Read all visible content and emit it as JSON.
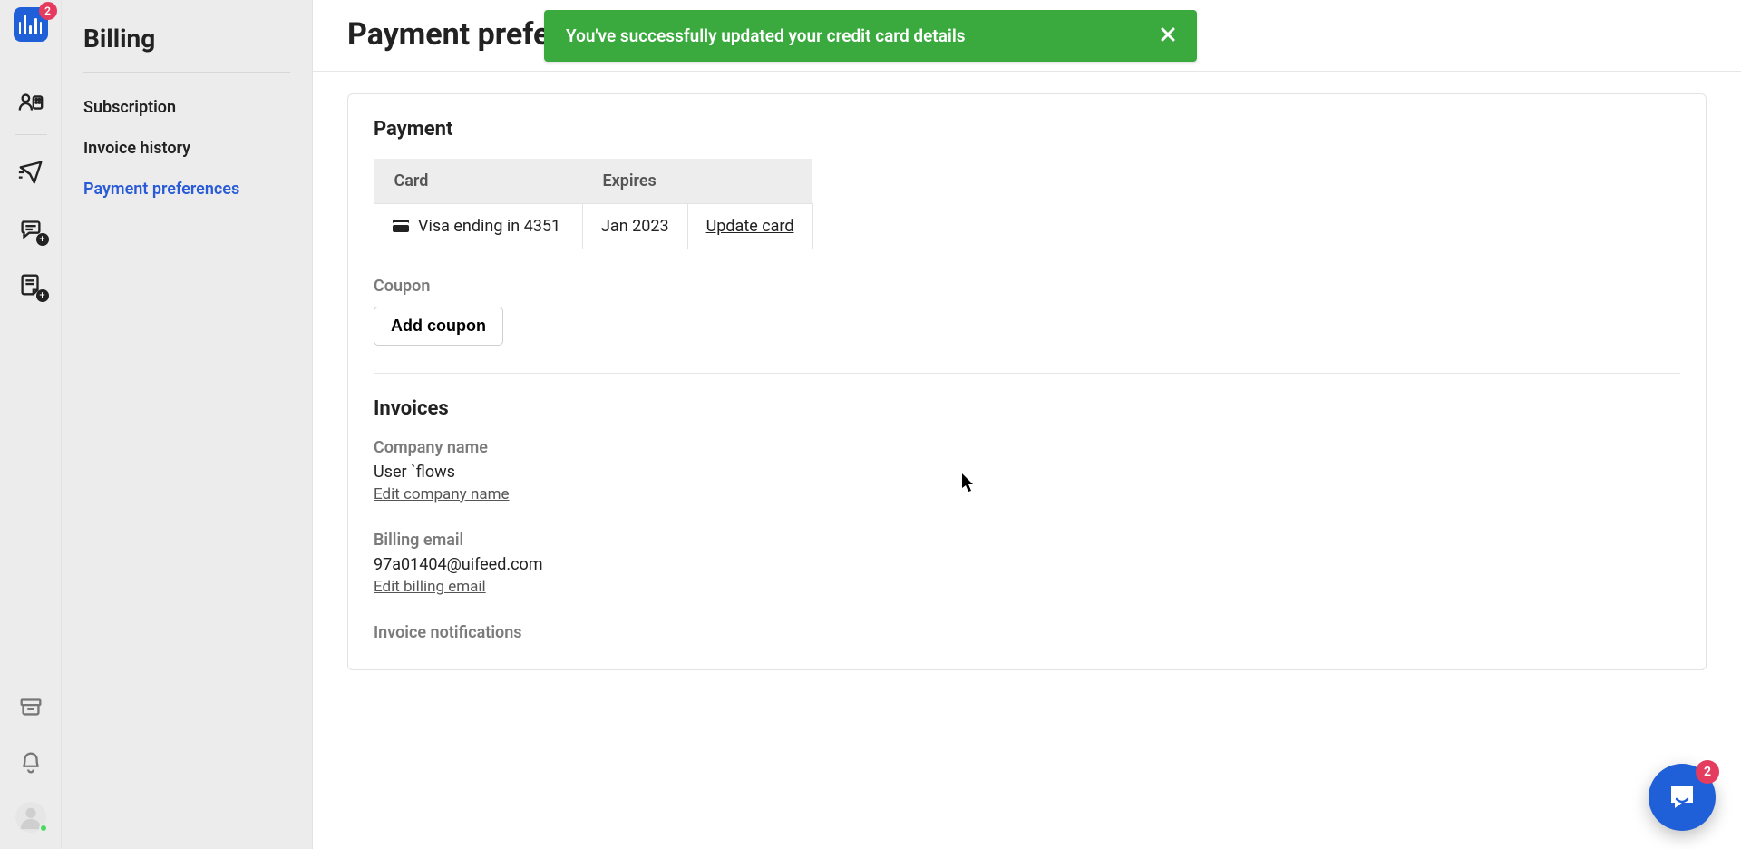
{
  "rail": {
    "logo_badge": "2"
  },
  "sidebar": {
    "title": "Billing",
    "items": [
      {
        "label": "Subscription"
      },
      {
        "label": "Invoice history"
      },
      {
        "label": "Payment preferences"
      }
    ]
  },
  "page": {
    "title": "Payment preferences"
  },
  "toast": {
    "message": "You've successfully updated your credit card details"
  },
  "payment": {
    "heading": "Payment",
    "col_card": "Card",
    "col_expires": "Expires",
    "card_text": "Visa ending in 4351",
    "expires_value": "Jan 2023",
    "update_link": "Update card"
  },
  "coupon": {
    "heading": "Coupon",
    "button": "Add coupon"
  },
  "invoices": {
    "heading": "Invoices",
    "company_label": "Company name",
    "company_value": "User `flows",
    "company_edit": "Edit company name",
    "email_label": "Billing email",
    "email_value": "97a01404@uifeed.com",
    "email_edit": "Edit billing email",
    "notifications_label": "Invoice notifications"
  },
  "chat": {
    "badge": "2"
  }
}
